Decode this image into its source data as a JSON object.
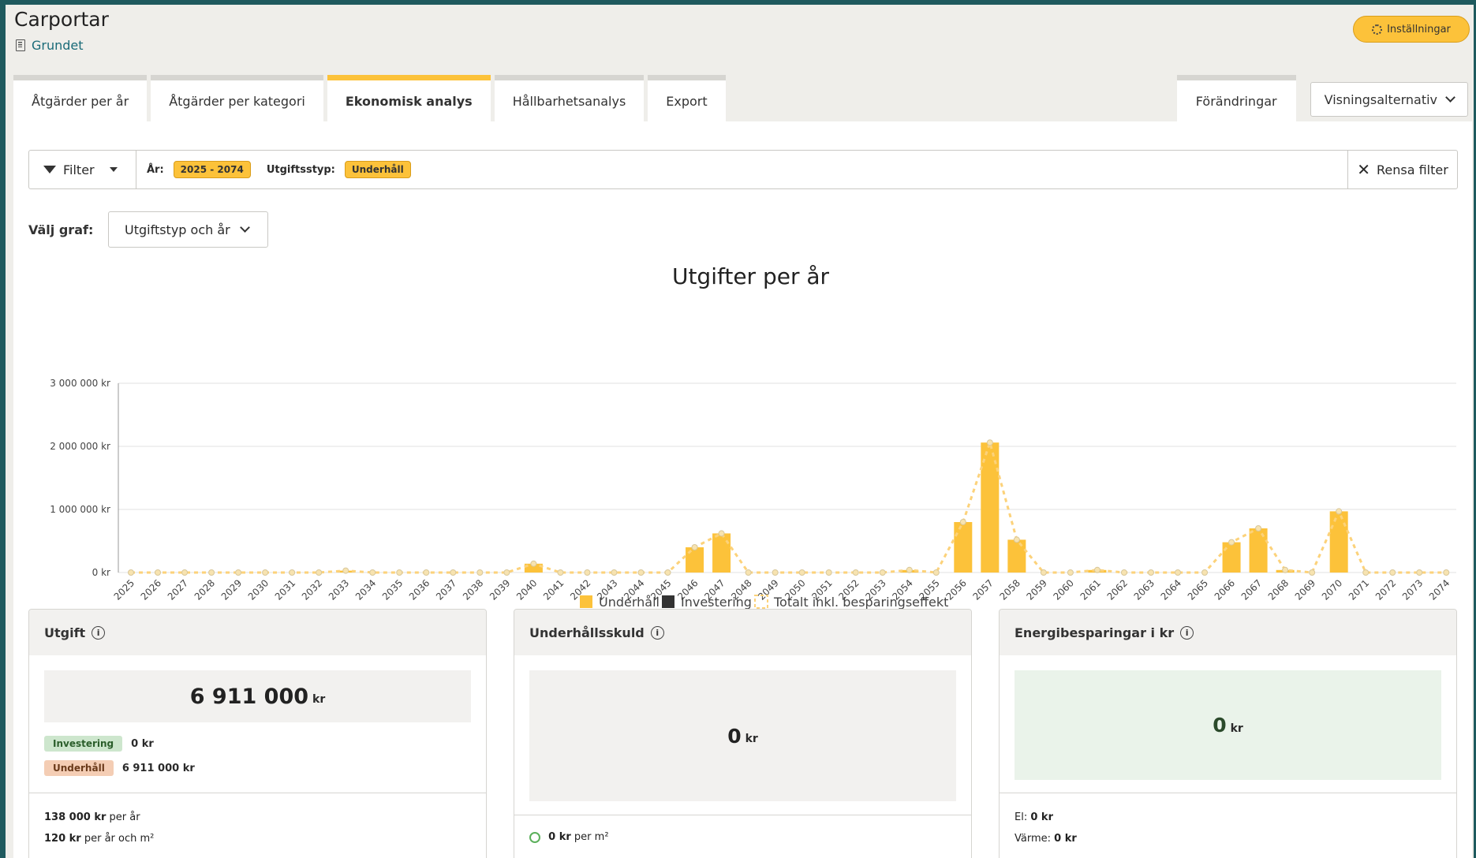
{
  "header": {
    "title": "Carportar",
    "building": "Grundet",
    "settings_label": "Inställningar"
  },
  "tabs": [
    {
      "label": "Åtgärder per år"
    },
    {
      "label": "Åtgärder per kategori"
    },
    {
      "label": "Ekonomisk analys"
    },
    {
      "label": "Hållbarhetsanalys"
    },
    {
      "label": "Export"
    }
  ],
  "right_tabs": {
    "changes": "Förändringar",
    "view_options": "Visningsalternativ"
  },
  "filter": {
    "button": "Filter",
    "year_label": "År:",
    "year_value": "2025 - 2074",
    "type_label": "Utgiftsstyp:",
    "type_value": "Underhåll",
    "clear": "Rensa filter"
  },
  "graph_select": {
    "label": "Välj graf:",
    "value": "Utgiftstyp och år"
  },
  "colors": {
    "accent": "#fcc23a",
    "investment": "#333333",
    "total_line": "#fcd27a"
  },
  "chart_data": {
    "type": "bar",
    "title": "Utgifter per år",
    "xlabel": "",
    "ylabel": "",
    "ylim": [
      0,
      3000000
    ],
    "yticks": [
      "0 kr",
      "1 000 000 kr",
      "2 000 000 kr",
      "3 000 000 kr"
    ],
    "ytick_values": [
      0,
      1000000,
      2000000,
      3000000
    ],
    "categories": [
      "2025",
      "2026",
      "2027",
      "2028",
      "2029",
      "2030",
      "2031",
      "2032",
      "2033",
      "2034",
      "2035",
      "2036",
      "2037",
      "2038",
      "2039",
      "2040",
      "2041",
      "2042",
      "2043",
      "2044",
      "2045",
      "2046",
      "2047",
      "2048",
      "2049",
      "2050",
      "2051",
      "2052",
      "2053",
      "2054",
      "2055",
      "2056",
      "2057",
      "2058",
      "2059",
      "2060",
      "2061",
      "2062",
      "2063",
      "2064",
      "2065",
      "2066",
      "2067",
      "2068",
      "2069",
      "2070",
      "2071",
      "2072",
      "2073",
      "2074"
    ],
    "series": [
      {
        "name": "Underhåll",
        "values": [
          0,
          0,
          0,
          0,
          0,
          0,
          0,
          0,
          30000,
          0,
          0,
          0,
          0,
          0,
          0,
          140000,
          0,
          0,
          0,
          0,
          0,
          400000,
          620000,
          0,
          0,
          0,
          0,
          0,
          0,
          40000,
          0,
          800000,
          2060000,
          520000,
          0,
          0,
          40000,
          0,
          0,
          0,
          0,
          480000,
          700000,
          40000,
          0,
          970000,
          0,
          0,
          0,
          0
        ]
      },
      {
        "name": "Investering",
        "values": [
          0,
          0,
          0,
          0,
          0,
          0,
          0,
          0,
          0,
          0,
          0,
          0,
          0,
          0,
          0,
          0,
          0,
          0,
          0,
          0,
          0,
          0,
          0,
          0,
          0,
          0,
          0,
          0,
          0,
          0,
          0,
          0,
          0,
          0,
          0,
          0,
          0,
          0,
          0,
          0,
          0,
          0,
          0,
          0,
          0,
          0,
          0,
          0,
          0,
          0
        ]
      },
      {
        "name": "Totalt inkl. besparingseffekt",
        "values": [
          0,
          0,
          0,
          0,
          0,
          0,
          0,
          0,
          30000,
          0,
          0,
          0,
          0,
          0,
          0,
          140000,
          0,
          0,
          0,
          0,
          0,
          400000,
          620000,
          0,
          0,
          0,
          0,
          0,
          0,
          40000,
          0,
          800000,
          2060000,
          520000,
          0,
          0,
          40000,
          0,
          0,
          0,
          0,
          480000,
          700000,
          40000,
          0,
          970000,
          0,
          0,
          0,
          0
        ]
      }
    ],
    "grid": true,
    "legend_position": "bottom"
  },
  "cards": {
    "expense": {
      "title": "Utgift",
      "value": "6 911 000",
      "unit": "kr",
      "investment_label": "Investering",
      "investment_value": "0 kr",
      "maintenance_label": "Underhåll",
      "maintenance_value": "6 911 000 kr",
      "per_year_value": "138 000 kr",
      "per_year_suffix": "per år",
      "per_year_m2_value": "120 kr",
      "per_year_m2_suffix": "per år och m²"
    },
    "debt": {
      "title": "Underhållsskuld",
      "value": "0",
      "unit": "kr",
      "per_m2_value": "0 kr",
      "per_m2_suffix": "per m²"
    },
    "energy": {
      "title": "Energibesparingar i kr",
      "value": "0",
      "unit": "kr",
      "el_label": "El:",
      "el_value": "0 kr",
      "heat_label": "Värme:",
      "heat_value": "0 kr"
    }
  }
}
